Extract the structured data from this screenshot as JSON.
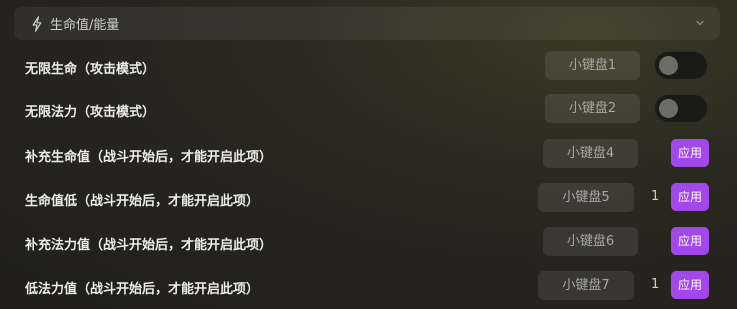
{
  "section": {
    "icon": "lightning-icon",
    "title": "生命值/能量",
    "collapse_icon": "chevron-down-icon"
  },
  "rows": [
    {
      "label": "无限生命（攻击模式）",
      "hotkey": "小键盘1",
      "control": "toggle",
      "enabled": false
    },
    {
      "label": "无限法力（攻击模式）",
      "hotkey": "小键盘2",
      "control": "toggle",
      "enabled": false
    },
    {
      "label": "补充生命值（战斗开始后，才能开启此项）",
      "hotkey": "小键盘4",
      "control": "apply",
      "apply_label": "应用"
    },
    {
      "label": "生命值低（战斗开始后，才能开启此项）",
      "hotkey": "小键盘5",
      "value": "1",
      "control": "apply",
      "apply_label": "应用"
    },
    {
      "label": "补充法力值（战斗开始后，才能开启此项）",
      "hotkey": "小键盘6",
      "control": "apply",
      "apply_label": "应用"
    },
    {
      "label": "低法力值（战斗开始后，才能开启此项）",
      "hotkey": "小键盘7",
      "value": "1",
      "control": "apply",
      "apply_label": "应用"
    }
  ],
  "colors": {
    "accent": "#a247ea",
    "toggle_off_knob": "#6c6c69"
  }
}
